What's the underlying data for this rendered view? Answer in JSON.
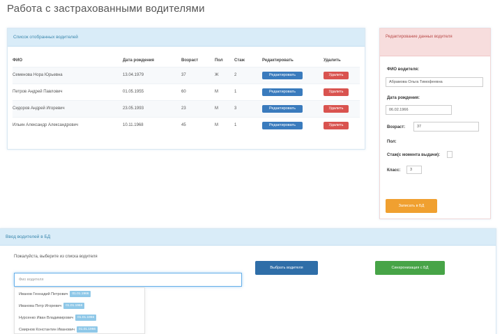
{
  "page": {
    "title": "Работа с застрахованными водителями"
  },
  "drivers_panel": {
    "heading": "Список отобранных водителей",
    "columns": [
      "ФИО",
      "Дата рождения",
      "Возраст",
      "Пол",
      "Стаж",
      "Редактировать",
      "Удалить"
    ],
    "rows": [
      {
        "name": "Семенова Нора Юрьевна",
        "dob": "13.04.1979",
        "age": "37",
        "sex": "Ж",
        "exp": "2",
        "edit": "Редактировать",
        "delete": "Удалить"
      },
      {
        "name": "Петров Андрей Павлович",
        "dob": "01.05.1955",
        "age": "60",
        "sex": "М",
        "exp": "1",
        "edit": "Редактировать",
        "delete": "Удалить"
      },
      {
        "name": "Сидоров Андрей Игоревич",
        "dob": "23.05.1993",
        "age": "23",
        "sex": "М",
        "exp": "3",
        "edit": "Редактировать",
        "delete": "Удалить"
      },
      {
        "name": "Ильин Александр Александрович",
        "dob": "10.11.1968",
        "age": "45",
        "sex": "М",
        "exp": "1",
        "edit": "Редактировать",
        "delete": "Удалить"
      }
    ]
  },
  "form_panel": {
    "heading": "Редактирование данных водителя",
    "fio_label": "ФИО водителя:",
    "fio_value": "Абрамова Ольга Тимофеевна",
    "dob_label": "Дата рождения:",
    "dob_value": "06.02.1966",
    "age_label": "Возраст:",
    "age_value": "37",
    "sex_label": "Пол:",
    "exp_label": "Стаж(с момента выдачи):",
    "class_label": "Класс:",
    "class_value": "3",
    "save_label": "Записать в БД"
  },
  "insured_panel": {
    "heading": "Ввод водителей в БД",
    "hint": "Пожалуйста, выберите из списка водителя",
    "search_placeholder": "Фио водителя",
    "add_label": "Выбрать водителя",
    "save_label": "Синхронизация с БД",
    "suggestions": [
      {
        "name": "Иванов Геннадий Петрович",
        "tag": "01.01.1966"
      },
      {
        "name": "Иванова Петр Игоревич",
        "tag": "01.01.1966"
      },
      {
        "name": "Нурсенко Иван Владимирович",
        "tag": "01.01.1966"
      },
      {
        "name": "Смирнов Константин Иванович",
        "tag": "01.01.1966"
      }
    ]
  }
}
